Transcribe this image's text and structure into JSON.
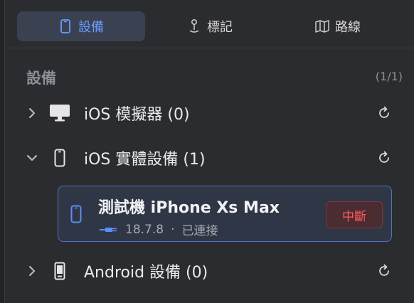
{
  "tabs": [
    {
      "label": "設備",
      "icon": "phone-icon",
      "active": true
    },
    {
      "label": "標記",
      "icon": "pin-icon",
      "active": false
    },
    {
      "label": "路線",
      "icon": "map-icon",
      "active": false
    }
  ],
  "section": {
    "title": "設備",
    "count": "(1/1)"
  },
  "groups": [
    {
      "label": "iOS 模擬器 (0)",
      "icon": "monitor-icon",
      "expanded": false
    },
    {
      "label": "iOS 實體設備 (1)",
      "icon": "iphone-icon",
      "expanded": true
    },
    {
      "label": "Android 設備 (0)",
      "icon": "android-phone-icon",
      "expanded": false
    }
  ],
  "device": {
    "name": "測試機 iPhone Xs Max",
    "version": "18.7.8",
    "separator": "·",
    "status": "已連接",
    "disconnect_label": "中斷",
    "icon": "cable-icon"
  },
  "colors": {
    "accent": "#6a9cff",
    "danger": "#ff5a5f",
    "card_border": "#4d74c4"
  }
}
